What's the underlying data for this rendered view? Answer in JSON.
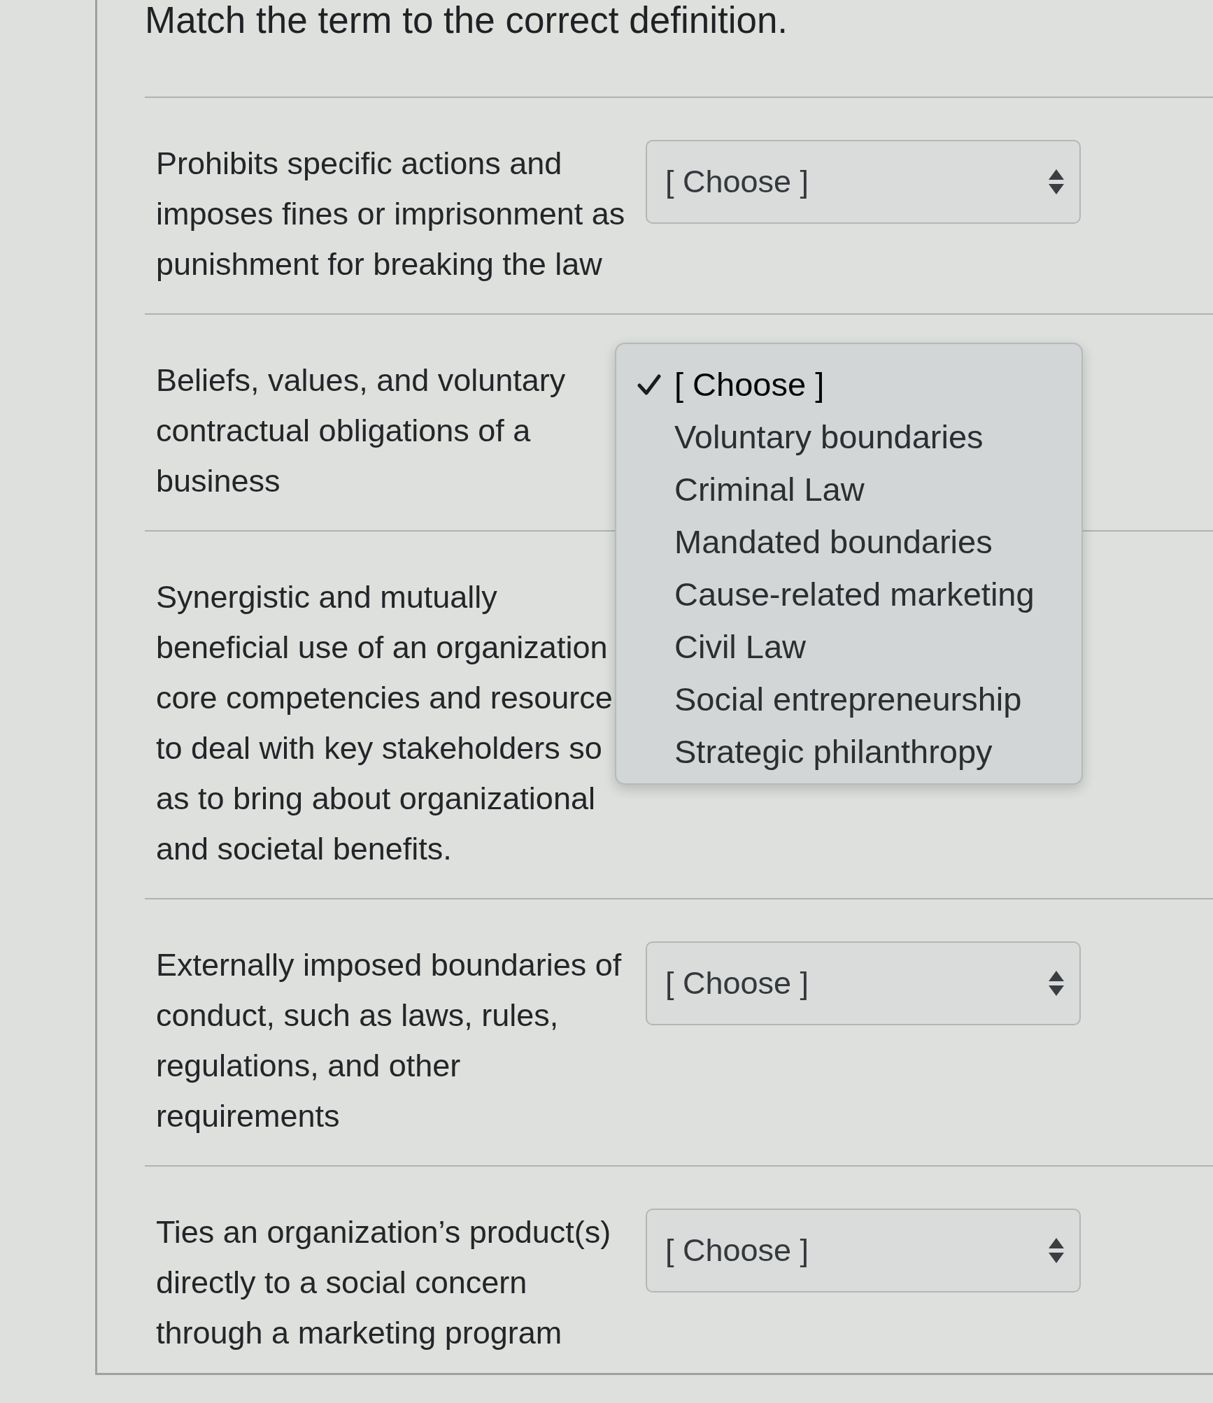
{
  "title": "Match the term to the correct definition.",
  "rows": [
    {
      "definition": "Prohibits specific actions and\nimposes fines or imprisonment as\npunishment for breaking the law",
      "select": {
        "value": "[ Choose ]"
      }
    },
    {
      "definition": "Beliefs, values, and voluntary\ncontractual obligations of a\nbusiness",
      "menu": {
        "options": [
          {
            "label": "[ Choose ]",
            "selected": true
          },
          {
            "label": "Voluntary boundaries",
            "selected": false
          },
          {
            "label": "Criminal Law",
            "selected": false
          },
          {
            "label": "Mandated boundaries",
            "selected": false
          },
          {
            "label": "Cause-related marketing",
            "selected": false
          },
          {
            "label": "Civil Law",
            "selected": false
          },
          {
            "label": "Social entrepreneurship",
            "selected": false
          },
          {
            "label": "Strategic philanthropy",
            "selected": false
          }
        ]
      }
    },
    {
      "definition": "Synergistic and mutually\nbeneficial use of an organization\ncore competencies and resource\nto deal with key stakeholders so\nas to bring about organizational\nand societal benefits."
    },
    {
      "definition": "Externally imposed boundaries of\nconduct, such as laws, rules,\nregulations, and other\nrequirements",
      "select": {
        "value": "[ Choose ]"
      }
    },
    {
      "definition": "Ties an organization’s product(s)\ndirectly to a social concern\nthrough a marketing program",
      "select": {
        "value": "[ Choose ]"
      }
    }
  ]
}
